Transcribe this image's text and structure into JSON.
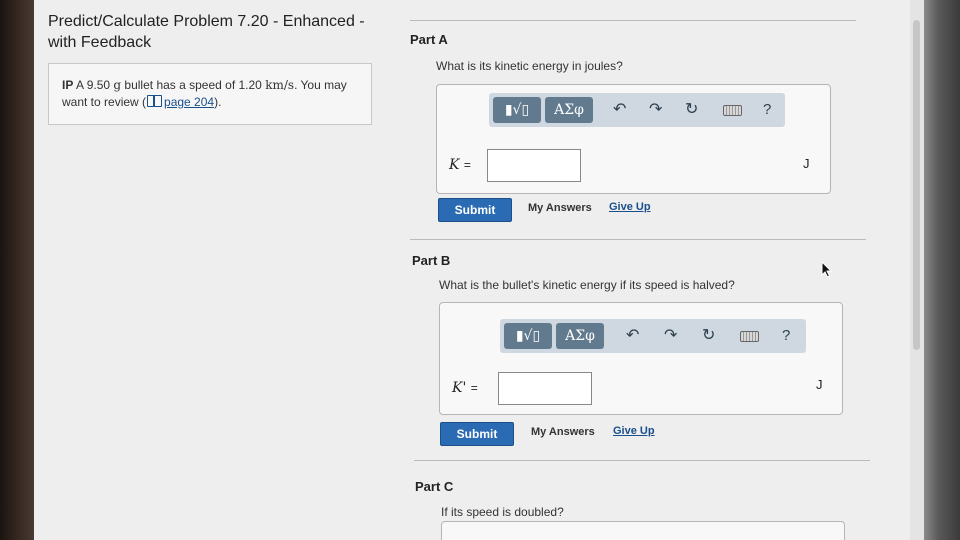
{
  "problem": {
    "title": "Predict/Calculate Problem 7.20 - Enhanced - with Feedback",
    "intro": {
      "tag": "IP",
      "text_a": "A 9.50",
      "unit_mass": "g",
      "text_b": "bullet has a speed of 1.20",
      "unit_speed": "km/s",
      "text_c": ". You may want to review (",
      "link": "page 204",
      "text_d": ")."
    }
  },
  "toolbar": {
    "template_label": "▮√▯",
    "greek_label": "ΑΣφ",
    "undo": "↶",
    "redo": "↷",
    "reset": "↻",
    "help": "?"
  },
  "parts": [
    {
      "label": "Part A",
      "question": "What is its kinetic energy in joules?",
      "variable": "K",
      "equals": "=",
      "input_value": "",
      "unit": "J",
      "submit": "Submit",
      "my_answers": "My Answers",
      "give_up": "Give Up"
    },
    {
      "label": "Part B",
      "question": "What is the bullet's kinetic energy if its speed is halved?",
      "variable": "K'",
      "equals": "=",
      "input_value": "",
      "unit": "J",
      "submit": "Submit",
      "my_answers": "My Answers",
      "give_up": "Give Up"
    },
    {
      "label": "Part C",
      "question": "If its speed is doubled?"
    }
  ]
}
